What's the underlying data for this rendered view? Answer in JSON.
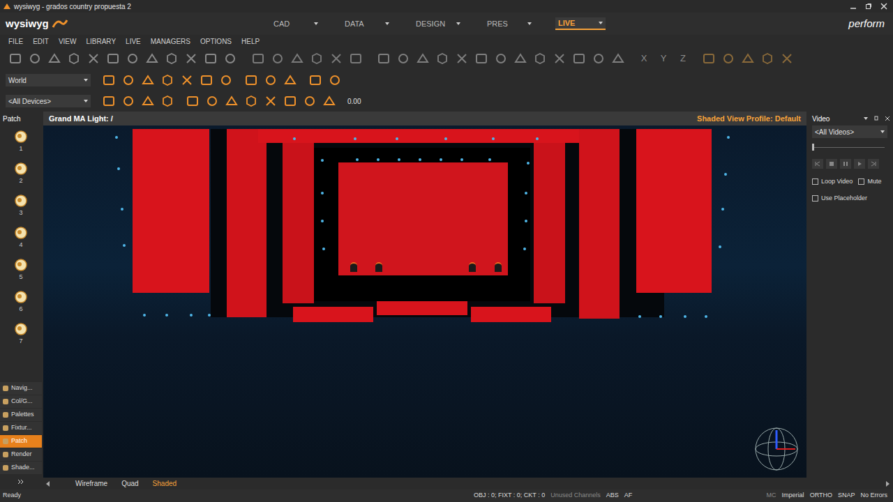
{
  "window": {
    "title": "wysiwyg - grados country propuesta 2"
  },
  "logo": {
    "text": "wysiwyg",
    "product": "perform"
  },
  "modes": [
    {
      "label": "CAD",
      "selected": false
    },
    {
      "label": "DATA",
      "selected": false
    },
    {
      "label": "DESIGN",
      "selected": false
    },
    {
      "label": "PRES",
      "selected": false
    },
    {
      "label": "LIVE",
      "selected": true
    }
  ],
  "menu": [
    "FILE",
    "EDIT",
    "VIEW",
    "LIBRARY",
    "LIVE",
    "MANAGERS",
    "OPTIONS",
    "HELP"
  ],
  "toolbar": {
    "axis_labels": [
      "X",
      "Y",
      "Z"
    ],
    "coordinate_selector": "World",
    "device_filter": "<All Devices>",
    "value": "0.00"
  },
  "patch_panel": {
    "title": "Patch",
    "items": [
      "1",
      "2",
      "3",
      "4",
      "5",
      "6",
      "7"
    ]
  },
  "nav_buttons": [
    {
      "label": "Navig...",
      "selected": false
    },
    {
      "label": "Col/G...",
      "selected": false
    },
    {
      "label": "Palettes",
      "selected": false
    },
    {
      "label": "Fixtur...",
      "selected": false
    },
    {
      "label": "Patch",
      "selected": true
    },
    {
      "label": "Render",
      "selected": false
    },
    {
      "label": "Shade...",
      "selected": false
    }
  ],
  "viewport": {
    "title": "Grand MA Light: /",
    "profile": "Shaded View Profile: Default"
  },
  "view_tabs": [
    {
      "label": "Wireframe",
      "selected": false
    },
    {
      "label": "Quad",
      "selected": false
    },
    {
      "label": "Shaded",
      "selected": true
    }
  ],
  "video_panel": {
    "title": "Video",
    "filter": "<All Videos>",
    "level": 0,
    "options": [
      {
        "label": "Loop Video",
        "checked": false
      },
      {
        "label": "Mute",
        "checked": false
      },
      {
        "label": "Use Placeholder",
        "checked": false
      }
    ]
  },
  "status_bar": {
    "left": "Ready",
    "counts": "OBJ : 0; FIXT : 0; CKT : 0",
    "items": [
      {
        "label": "Unused Channels",
        "dimmed": true
      },
      {
        "label": "ABS",
        "dimmed": false
      },
      {
        "label": "AF",
        "dimmed": false
      }
    ],
    "right": [
      "MC",
      "Imperial",
      "ORTHO",
      "SNAP",
      "No Errors"
    ]
  }
}
